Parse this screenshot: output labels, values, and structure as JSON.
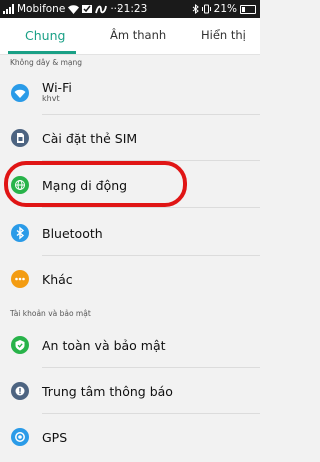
{
  "status": {
    "carrier": "Mobifone",
    "time": "21:23",
    "battery": "21%"
  },
  "tabs": [
    "Chung",
    "Âm thanh",
    "Hiển thị"
  ],
  "sections": {
    "wireless": "Không dây & mạng",
    "account": "Tài khoản và bảo mật"
  },
  "items": [
    {
      "label": "Wi-Fi",
      "sub": "khvt",
      "icon": "wifi-icon",
      "color": "#2a9be8"
    },
    {
      "label": "Cài đặt thẻ SIM",
      "icon": "sim-card-icon",
      "color": "#4d6481"
    },
    {
      "label": "Mạng di động",
      "icon": "globe-icon",
      "color": "#28b34a"
    },
    {
      "label": "Bluetooth",
      "icon": "bluetooth-icon",
      "color": "#2a9be8"
    },
    {
      "label": "Khác",
      "icon": "more-icon",
      "color": "#f39c12"
    },
    {
      "label": "An toàn và bảo mật",
      "icon": "shield-icon",
      "color": "#28b34a"
    },
    {
      "label": "Trung tâm thông báo",
      "icon": "notification-icon",
      "color": "#4d6481"
    },
    {
      "label": "GPS",
      "icon": "location-icon",
      "color": "#2a9be8"
    }
  ]
}
